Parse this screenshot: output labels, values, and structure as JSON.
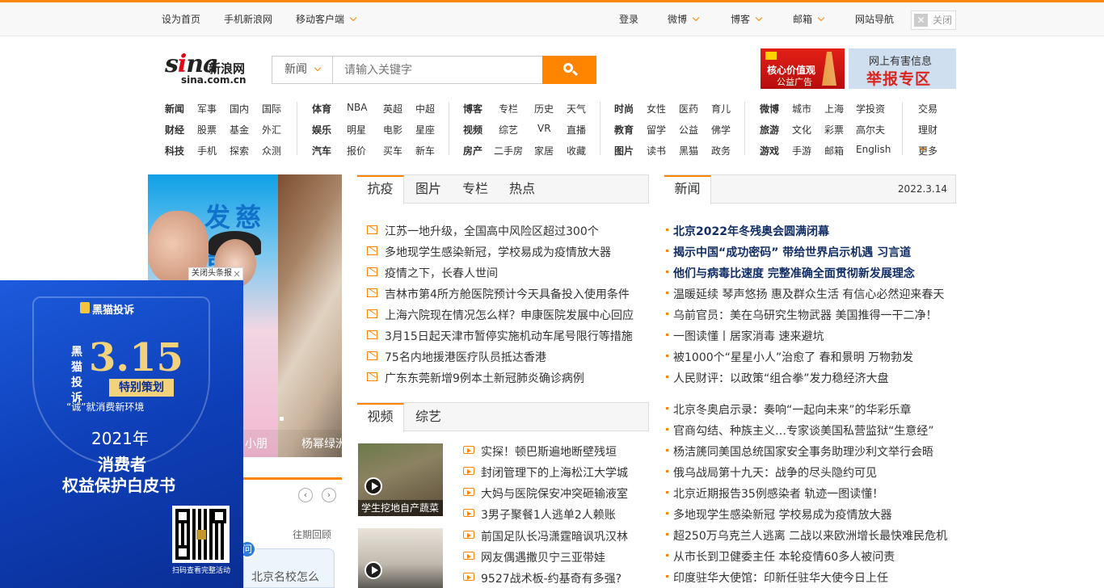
{
  "topbar": {
    "home": "设为首页",
    "mobile_sina": "手机新浪网",
    "mobile_client": "移动客户端",
    "login": "登录",
    "weibo": "微博",
    "blog": "博客",
    "mail": "邮箱",
    "site_nav": "网站导航",
    "close": "关闭"
  },
  "logo": {
    "cn": "新浪网",
    "domain": "sina.com.cn"
  },
  "search": {
    "category": "新闻",
    "placeholder": "请输入关键字"
  },
  "ads": {
    "ad1_line1": "核心价值观",
    "ad1_line2": "公益广告",
    "ad2_line1": "网上有害信息",
    "ad2_line2": "举报专区"
  },
  "nav": {
    "col1": [
      [
        "新闻",
        "军事",
        "国内",
        "国际"
      ],
      [
        "财经",
        "股票",
        "基金",
        "外汇"
      ],
      [
        "科技",
        "手机",
        "探索",
        "众测"
      ]
    ],
    "col2": [
      [
        "体育",
        "NBA",
        "英超",
        "中超"
      ],
      [
        "娱乐",
        "明星",
        "电影",
        "星座"
      ],
      [
        "汽车",
        "报价",
        "买车",
        "新车"
      ]
    ],
    "col3": [
      [
        "博客",
        "专栏",
        "历史",
        "天气"
      ],
      [
        "视频",
        "综艺",
        "VR",
        "直播"
      ],
      [
        "房产",
        "二手房",
        "家居",
        "收藏"
      ]
    ],
    "col4": [
      [
        "时尚",
        "女性",
        "医药",
        "育儿"
      ],
      [
        "教育",
        "留学",
        "公益",
        "佛学"
      ],
      [
        "图片",
        "读书",
        "黑猫",
        "政务"
      ]
    ],
    "col5": [
      [
        "微博",
        "城市",
        "上海",
        "学投资"
      ],
      [
        "旅游",
        "文化",
        "彩票",
        "高尔夫"
      ],
      [
        "游戏",
        "手游",
        "邮箱",
        "English"
      ]
    ],
    "col6": [
      "交易",
      "理财",
      "更多"
    ]
  },
  "slider": {
    "sign_text": "发慈善",
    "caption1": "小朋",
    "caption2": "杨幂绿洲",
    "close_ad": "关闭头条报"
  },
  "float_ad": {
    "brand": "黑猫投诉",
    "vertical": "黑猫投诉",
    "big": "3.15",
    "tag": "特别策划",
    "sub": "“诚”就消费新环境",
    "year": "2021年",
    "line2": "消费者",
    "line3": "权益保护白皮书",
    "scan": "扫码查看完整活动"
  },
  "mini": {
    "prev": "‹",
    "next": "›",
    "past": "往期回顾",
    "card_text": "北京名校怎么",
    "badge": "问"
  },
  "mid_tabs": [
    "抗疫",
    "图片",
    "专栏",
    "热点"
  ],
  "mid_news": [
    "江苏一地升级，全国高中风险区超过300个",
    "多地现学生感染新冠，学校易成为疫情放大器",
    "疫情之下，长春人世间",
    "吉林市第4所方舱医院预计今天具备投入使用条件",
    "上海六院现在情况怎么样？申康医院发展中心回应",
    "3月15日起天津市暂停实施机动车尾号限行等措施",
    "75名内地援港医疗队员抵达香港",
    "广东东莞新增9例本土新冠肺炎确诊病例"
  ],
  "video_tabs": [
    "视频",
    "综艺"
  ],
  "thumbs": [
    {
      "caption": "学生挖地自产蔬菜"
    },
    {
      "caption": ""
    }
  ],
  "video_news": [
    "实探！顿巴斯遍地断壁残垣",
    "封闭管理下的上海松江大学城",
    "大妈与医院保安冲突砸输液室",
    "3男子聚餐1人逃单2人赖账",
    "前国足队长冯潇霆暗讽巩汉林",
    "网友偶遇撒贝宁三亚带娃",
    "9527战术板-约基奇有多强?"
  ],
  "right": {
    "tab": "新闻",
    "date": "2022.3.14",
    "headlines": [
      "北京2022年冬残奥会圆满闭幕",
      "揭示中国“成功密码” 带给世界启示机遇 习言道",
      "他们与病毒比速度 完整准确全面贯彻新发展理念"
    ],
    "news1": [
      "温暖延续 琴声悠扬 惠及群众生活 有信心必然迎来春天",
      "乌前官员：美在乌研究生物武器 美国推得一干二净！",
      "一图读懂丨居家消毒 速来避坑",
      "被1000个“星星小人”治愈了 春和景明 万物勃发",
      "人民财评：以政策“组合拳”发力稳经济大盘"
    ],
    "news2": [
      "北京冬奥启示录：奏响“一起向未来”的华彩乐章",
      "官商勾结、种族主义…专家谈美国私营监狱“生意经”",
      "杨洁篪同美国总统国家安全事务助理沙利文举行会晤",
      "俄乌战局第十九天：战争的尽头隐约可见",
      "北京近期报告35例感染者 轨迹一图读懂！",
      "多地现学生感染新冠 学校易成为疫情放大器",
      "超250万乌克兰人逃离 二战以来欧洲增长最快难民危机",
      "从市长到卫健委主任 本轮疫情60多人被问责",
      "印度驻华大使馆：印新任驻华大使今日上任"
    ]
  }
}
